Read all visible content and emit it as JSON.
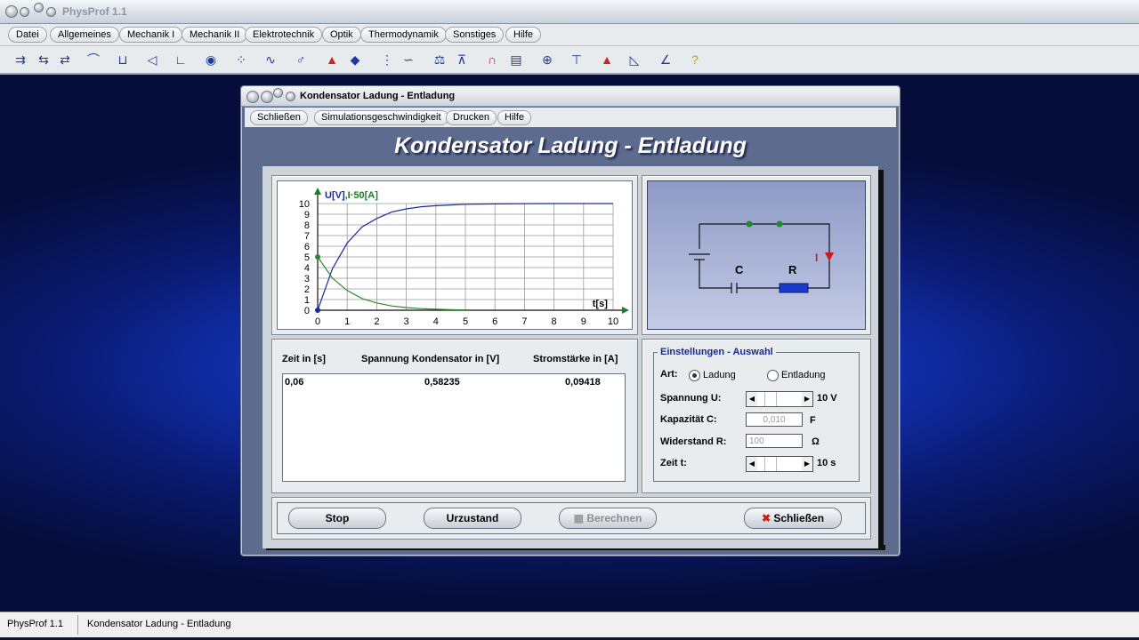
{
  "app": {
    "title": "PhysProf 1.1"
  },
  "menubar": [
    "Datei",
    "Allgemeines",
    "Mechanik I",
    "Mechanik II",
    "Elektrotechnik",
    "Optik",
    "Thermodynamik",
    "Sonstiges",
    "Hilfe"
  ],
  "toolbar_icons": [
    "vector-add-icon",
    "vector-subtract-icon",
    "transform-icon",
    "slope-icon",
    "pressure-icon",
    "lens-icon",
    "graph-icon",
    "eye-icon",
    "dots-icon",
    "wave-icon",
    "male-symbol-icon",
    "fluid-icon",
    "fluid-rotate-icon",
    "spring-icon",
    "curve-icon",
    "scale-icon",
    "balance-icon",
    "magnet-icon",
    "car-icon",
    "transistor-icon",
    "gauge-icon",
    "triangle-icon",
    "histogram-icon",
    "distribution-icon",
    "help-icon"
  ],
  "dialog": {
    "title": "Kondensator Ladung - Entladung",
    "menu": [
      "Schließen",
      "Simulationsgeschwindigkeit",
      "Drucken",
      "Hilfe"
    ],
    "heading": "Kondensator Ladung - Entladung"
  },
  "chart_data": {
    "type": "line",
    "ylabel_u": "U[V]",
    "ylabel_i": ",I·50[A]",
    "xlabel": "t[s]",
    "xlim": [
      0,
      10
    ],
    "ylim": [
      0,
      10
    ],
    "x_ticks": [
      "0",
      "1",
      "2",
      "3",
      "4",
      "5",
      "6",
      "7",
      "8",
      "9",
      "10"
    ],
    "y_ticks": [
      "0",
      "1",
      "2",
      "3",
      "4",
      "5",
      "6",
      "7",
      "8",
      "9",
      "10"
    ],
    "grid": true,
    "series": [
      {
        "color": "#1a2a9a",
        "x": [
          0,
          0.5,
          1,
          1.5,
          2,
          2.5,
          3,
          3.5,
          4,
          5,
          6,
          7,
          8,
          9,
          10
        ],
        "y": [
          0,
          3.9,
          6.3,
          7.8,
          8.6,
          9.2,
          9.5,
          9.7,
          9.8,
          9.93,
          9.97,
          9.99,
          10,
          10,
          10
        ]
      },
      {
        "color": "#2a8a2a",
        "x": [
          0,
          0.5,
          1,
          1.5,
          2,
          2.5,
          3,
          3.5,
          4,
          4.5,
          5
        ],
        "y": [
          5,
          3.0,
          1.85,
          1.1,
          0.68,
          0.4,
          0.25,
          0.15,
          0.09,
          0.05,
          0.03
        ]
      }
    ]
  },
  "circuit": {
    "label_c": "C",
    "label_r": "R",
    "label_i": "I"
  },
  "table": {
    "headers": [
      "Zeit in [s]",
      "Spannung Kondensator in [V]",
      "Stromstärke in [A]"
    ],
    "row": [
      "0,06",
      "0,58235",
      "0,09418"
    ]
  },
  "settings": {
    "legend": "Einstellungen - Auswahl",
    "art_label": "Art:",
    "radio_ladung": "Ladung",
    "radio_entladung": "Entladung",
    "selected": "Ladung",
    "spannung_label": "Spannung U:",
    "spannung_value": "10 V",
    "spannung_fraction": 0.2,
    "kapazitaet_label": "Kapazität C:",
    "kapazitaet_value": "0,010",
    "kapazitaet_unit": "F",
    "widerstand_label": "Widerstand R:",
    "widerstand_value": "100",
    "widerstand_unit": "Ω",
    "zeit_label": "Zeit t:",
    "zeit_value": "10 s",
    "zeit_fraction": 0.2
  },
  "buttons": {
    "stop": "Stop",
    "reset": "Urzustand",
    "compute": "Berechnen",
    "close": "Schließen"
  },
  "status": {
    "app": "PhysProf 1.1",
    "window": "Kondensator Ladung - Entladung"
  }
}
